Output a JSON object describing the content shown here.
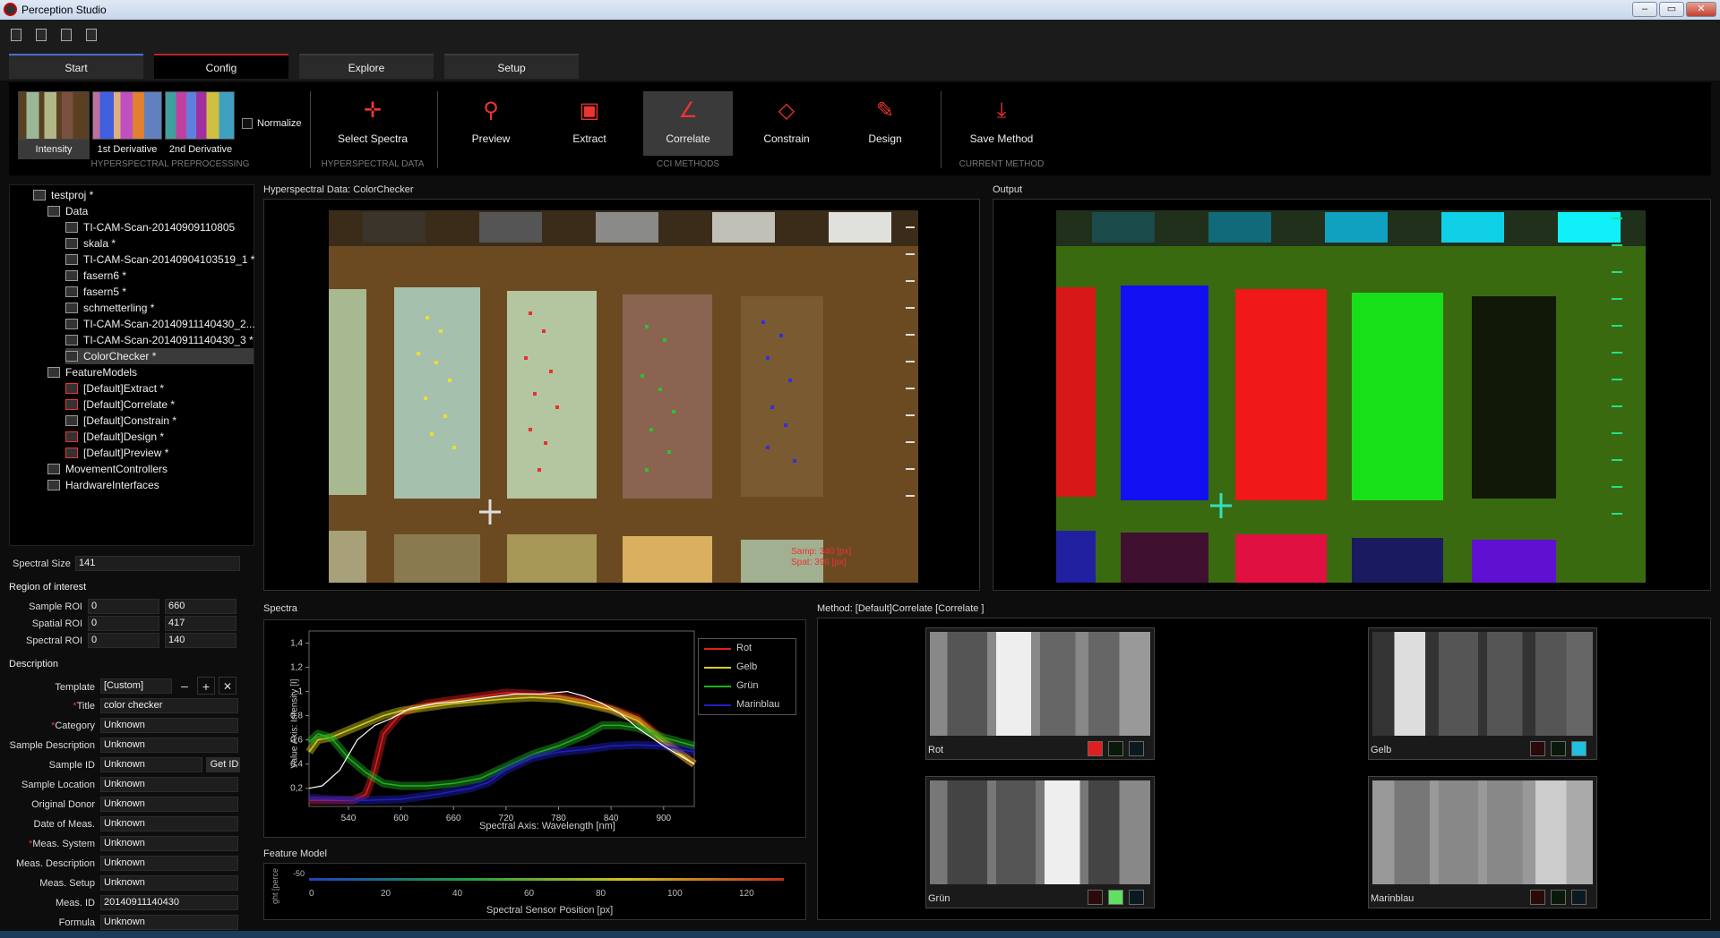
{
  "window": {
    "title": "Perception Studio"
  },
  "tabs": [
    {
      "label": "Start"
    },
    {
      "label": "Config"
    },
    {
      "label": "Explore"
    },
    {
      "label": "Setup"
    }
  ],
  "ribbon": {
    "preprocessing": {
      "items": [
        {
          "label": "Intensity"
        },
        {
          "label": "1st Derivative"
        },
        {
          "label": "2nd Derivative"
        }
      ],
      "normalize_label": "Normalize",
      "group_label": "HYPERSPECTRAL PREPROCESSING"
    },
    "data": {
      "button": "Select Spectra",
      "group_label": "HYPERSPECTRAL DATA"
    },
    "methods": {
      "buttons": [
        {
          "label": "Preview"
        },
        {
          "label": "Extract"
        },
        {
          "label": "Correlate"
        },
        {
          "label": "Constrain"
        },
        {
          "label": "Design"
        }
      ],
      "group_label": "CCI METHODS"
    },
    "current": {
      "button": "Save Method",
      "group_label": "CURRENT METHOD"
    }
  },
  "tree": {
    "root": "testproj *",
    "data_folder": "Data",
    "data_items": [
      "TI-CAM-Scan-20140909110805",
      "skala *",
      "TI-CAM-Scan-20140904103519_1 *",
      "fasern6 *",
      "fasern5 *",
      "schmetterling *",
      "TI-CAM-Scan-20140911140430_2...",
      "TI-CAM-Scan-20140911140430_3 *",
      "ColorChecker *"
    ],
    "models_folder": "FeatureModels",
    "model_items": [
      "[Default]Extract *",
      "[Default]Correlate *",
      "[Default]Constrain *",
      "[Default]Design *",
      "[Default]Preview *"
    ],
    "other": [
      "MovementControllers",
      "HardwareInterfaces"
    ]
  },
  "spectral_size": {
    "label": "Spectral Size",
    "value": "141"
  },
  "roi": {
    "title": "Region of interest",
    "rows": [
      {
        "label": "Sample ROI",
        "from": "0",
        "to": "660"
      },
      {
        "label": "Spatial ROI",
        "from": "0",
        "to": "417"
      },
      {
        "label": "Spectral ROI",
        "from": "0",
        "to": "140"
      }
    ]
  },
  "description": {
    "title": "Description",
    "template_label": "Template",
    "template_value": "[Custom]",
    "get_id": "Get ID",
    "fields": [
      {
        "label": "Title",
        "value": "color checker",
        "req": "*"
      },
      {
        "label": "Category",
        "value": "Unknown",
        "req": "*"
      },
      {
        "label": "Sample Description",
        "value": "Unknown",
        "req": ""
      },
      {
        "label": "Sample ID",
        "value": "Unknown",
        "req": ""
      },
      {
        "label": "Sample Location",
        "value": "Unknown",
        "req": ""
      },
      {
        "label": "Original Donor",
        "value": "Unknown",
        "req": ""
      },
      {
        "label": "Date of Meas.",
        "value": "Unknown",
        "req": ""
      },
      {
        "label": "Meas. System",
        "value": "Unknown",
        "req": "*"
      },
      {
        "label": "Meas. Description",
        "value": "Unknown",
        "req": ""
      },
      {
        "label": "Meas. Setup",
        "value": "Unknown",
        "req": ""
      },
      {
        "label": "Meas. ID",
        "value": "20140911140430",
        "req": ""
      },
      {
        "label": "Formula",
        "value": "Unknown",
        "req": ""
      }
    ]
  },
  "hyper_panel": {
    "title": "Hyperspectral Data: ColorChecker",
    "overlay1": "Samp: 340 [px]",
    "overlay2": "Spat: 396 [px]"
  },
  "output_panel": {
    "title": "Output"
  },
  "spectra_panel": {
    "title": "Spectra"
  },
  "feature_panel": {
    "title": "Feature Model",
    "xlabel": "Spectral Sensor Position [px]",
    "ylabel": "ght [perce",
    "xticks": [
      "0",
      "20",
      "40",
      "60",
      "80",
      "100",
      "120"
    ],
    "ytick": "-50"
  },
  "method_panel": {
    "title": "Method: [Default]Correlate [Correlate ]",
    "channels": [
      {
        "label": "Rot"
      },
      {
        "label": "Gelb"
      },
      {
        "label": "Grün"
      },
      {
        "label": "Marinblau"
      }
    ]
  },
  "colors": {
    "rot": "#e02020",
    "gelb": "#d8d020",
    "gruen": "#20b020",
    "marinblau": "#2020c0",
    "accent": "#c02020"
  },
  "chart_data": {
    "type": "line",
    "xlabel": "Spectral Axis: Wavelength [nm]",
    "ylabel": "Value Axis: Intensity [I]",
    "xlim": [
      495,
      935
    ],
    "ylim": [
      0.05,
      1.5
    ],
    "xticks": [
      540,
      600,
      660,
      720,
      780,
      840,
      900
    ],
    "yticks": [
      0.2,
      0.4,
      0.6,
      0.8,
      1.0,
      1.2,
      1.4
    ],
    "ytick_labels": [
      "0,2",
      "0,4",
      "0,6",
      "0,8",
      "1",
      "1,2",
      "1,4"
    ],
    "legend_position": "top-right",
    "series": [
      {
        "name": "Rot",
        "color": "#e02020",
        "x": [
          495,
          520,
          545,
          560,
          570,
          580,
          600,
          630,
          660,
          690,
          720,
          750,
          780,
          810,
          840,
          870,
          900,
          935
        ],
        "y": [
          0.1,
          0.1,
          0.1,
          0.15,
          0.35,
          0.65,
          0.82,
          0.9,
          0.93,
          0.96,
          0.99,
          0.98,
          0.96,
          0.92,
          0.86,
          0.78,
          0.6,
          0.4
        ]
      },
      {
        "name": "Gelb",
        "color": "#d8d020",
        "x": [
          495,
          505,
          520,
          540,
          560,
          580,
          600,
          630,
          660,
          690,
          720,
          750,
          780,
          810,
          840,
          870,
          900,
          935
        ],
        "y": [
          0.5,
          0.6,
          0.62,
          0.68,
          0.74,
          0.8,
          0.84,
          0.87,
          0.9,
          0.92,
          0.94,
          0.95,
          0.94,
          0.9,
          0.85,
          0.76,
          0.58,
          0.4
        ]
      },
      {
        "name": "Grün",
        "color": "#20b020",
        "x": [
          495,
          505,
          520,
          540,
          560,
          580,
          600,
          630,
          660,
          690,
          720,
          750,
          780,
          810,
          830,
          850,
          870,
          900,
          935
        ],
        "y": [
          0.58,
          0.65,
          0.62,
          0.45,
          0.33,
          0.24,
          0.22,
          0.22,
          0.24,
          0.28,
          0.38,
          0.48,
          0.55,
          0.64,
          0.72,
          0.72,
          0.7,
          0.62,
          0.55
        ]
      },
      {
        "name": "Marinblau",
        "color": "#2020c0",
        "x": [
          495,
          520,
          560,
          600,
          640,
          680,
          700,
          720,
          750,
          780,
          810,
          840,
          870,
          900,
          935
        ],
        "y": [
          0.12,
          0.11,
          0.1,
          0.11,
          0.15,
          0.2,
          0.25,
          0.35,
          0.45,
          0.5,
          0.52,
          0.55,
          0.56,
          0.55,
          0.5
        ]
      },
      {
        "name": "",
        "color": "#ffffff",
        "x": [
          495,
          510,
          530,
          550,
          570,
          590,
          610,
          640,
          670,
          700,
          730,
          760,
          790,
          810,
          830,
          850,
          870,
          900,
          935
        ],
        "y": [
          0.2,
          0.22,
          0.35,
          0.6,
          0.72,
          0.78,
          0.86,
          0.9,
          0.92,
          0.95,
          0.98,
          0.98,
          1.0,
          0.96,
          0.9,
          0.82,
          0.7,
          0.55,
          0.4
        ]
      }
    ]
  }
}
